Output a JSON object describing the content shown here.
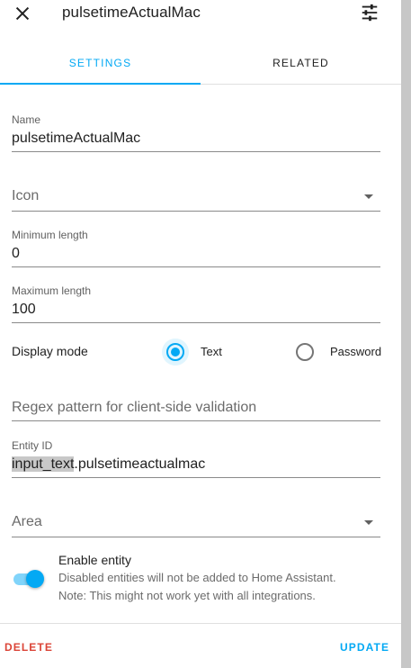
{
  "dialog": {
    "title": "pulsetimeActualMac"
  },
  "tabs": [
    {
      "label": "SETTINGS",
      "active": true
    },
    {
      "label": "RELATED",
      "active": false
    }
  ],
  "form": {
    "name": {
      "label": "Name",
      "value": "pulsetimeActualMac"
    },
    "icon": {
      "placeholder": "Icon"
    },
    "min_length": {
      "label": "Minimum length",
      "value": "0"
    },
    "max_length": {
      "label": "Maximum length",
      "value": "100"
    },
    "display_mode": {
      "label": "Display mode",
      "options": [
        {
          "label": "Text",
          "selected": true
        },
        {
          "label": "Password",
          "selected": false
        }
      ]
    },
    "regex": {
      "placeholder": "Regex pattern for client-side validation"
    },
    "entity_id": {
      "label": "Entity ID",
      "prefix": "input_text",
      "suffix": ".pulsetimeactualmac"
    },
    "area": {
      "placeholder": "Area"
    },
    "enable_entity": {
      "title": "Enable entity",
      "enabled": true,
      "description_line1": "Disabled entities will not be added to Home Assistant.",
      "description_line2": "Note: This might not work yet with all integrations."
    }
  },
  "actions": {
    "delete_label": "DELETE",
    "update_label": "UPDATE"
  },
  "background": {
    "fragment_1": "al",
    "fragment_2": "ct"
  },
  "colors": {
    "accent": "#03a9f4",
    "delete": "#db4437"
  },
  "icons": [
    "close-icon",
    "tune-icon",
    "chevron-down-icon"
  ]
}
